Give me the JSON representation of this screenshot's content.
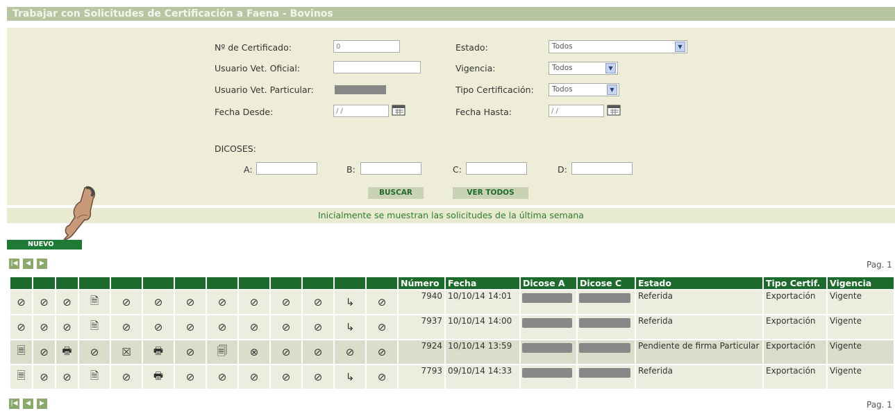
{
  "title": "Trabajar con Solicitudes de Certificación a Faena - Bovinos",
  "filters": {
    "certificado_label": "Nº de Certificado:",
    "certificado_value": "0",
    "usuario_oficial_label": "Usuario Vet. Oficial:",
    "usuario_oficial_value": "",
    "usuario_particular_label": "Usuario Vet. Particular:",
    "fecha_desde_label": "Fecha Desde:",
    "fecha_desde_value": "/ /",
    "estado_label": "Estado:",
    "estado_value": "Todos",
    "vigencia_label": "Vigencia:",
    "vigencia_value": "Todos",
    "tipo_label": "Tipo Certificación:",
    "tipo_value": "Todos",
    "fecha_hasta_label": "Fecha Hasta:",
    "fecha_hasta_value": "/ /",
    "dicoses_label": "DICOSES:",
    "a_label": "A:",
    "b_label": "B:",
    "c_label": "C:",
    "d_label": "D:"
  },
  "buttons": {
    "buscar": "BUSCAR",
    "ver_todos": "VER TODOS",
    "nuevo": "NUEVO"
  },
  "info_text": "Inicialmente se muestran las solicitudes de la última semana",
  "pager": {
    "label": "Pag. 1",
    "first_icon": "first-page-icon",
    "prev_icon": "prev-page-icon",
    "next_icon": "next-page-icon"
  },
  "table": {
    "headers": [
      "Número",
      "Fecha",
      "Dicose A",
      "Dicose C",
      "Estado",
      "Tipo Certif.",
      "Vigencia"
    ],
    "rows": [
      {
        "icons": [
          "⊘",
          "⊘",
          "⊘",
          "🗎",
          "⊘",
          "⊘",
          "⊘",
          "⊘",
          "⊘",
          "⊘",
          "⊘",
          "↳",
          "⊘"
        ],
        "numero": "7940",
        "fecha": "10/10/14 14:01",
        "estado": "Referida",
        "tipo": "Exportación",
        "vigencia": "Vigente"
      },
      {
        "icons": [
          "⊘",
          "⊘",
          "⊘",
          "🗎",
          "⊘",
          "⊘",
          "⊘",
          "⊘",
          "⊘",
          "⊘",
          "⊘",
          "↳",
          "⊘"
        ],
        "numero": "7937",
        "fecha": "10/10/14 14:00",
        "estado": "Referida",
        "tipo": "Exportación",
        "vigencia": "Vigente"
      },
      {
        "icons": [
          "🗏",
          "⊘",
          "🖶",
          "⊘",
          "☒",
          "🖶",
          "⊘",
          "🗐",
          "⊗",
          "⊘",
          "⊘",
          "⊘",
          "⊘"
        ],
        "numero": "7924",
        "fecha": "10/10/14 13:59",
        "estado": "Pendiente de firma Particular",
        "tipo": "Exportación",
        "vigencia": "Vigente"
      },
      {
        "icons": [
          "🗏",
          "⊘",
          "⊘",
          "🗎",
          "⊘",
          "🖶",
          "⊘",
          "⊘",
          "⊘",
          "⊘",
          "⊘",
          "↳",
          "⊘"
        ],
        "numero": "7793",
        "fecha": "09/10/14 14:33",
        "estado": "Referida",
        "tipo": "Exportación",
        "vigencia": "Vigente"
      }
    ]
  },
  "colors": {
    "header_green": "#1d6b2c",
    "panel_bg": "#eeeed8",
    "title_bar": "#b7c5a3",
    "info_text": "#2e7d32"
  }
}
